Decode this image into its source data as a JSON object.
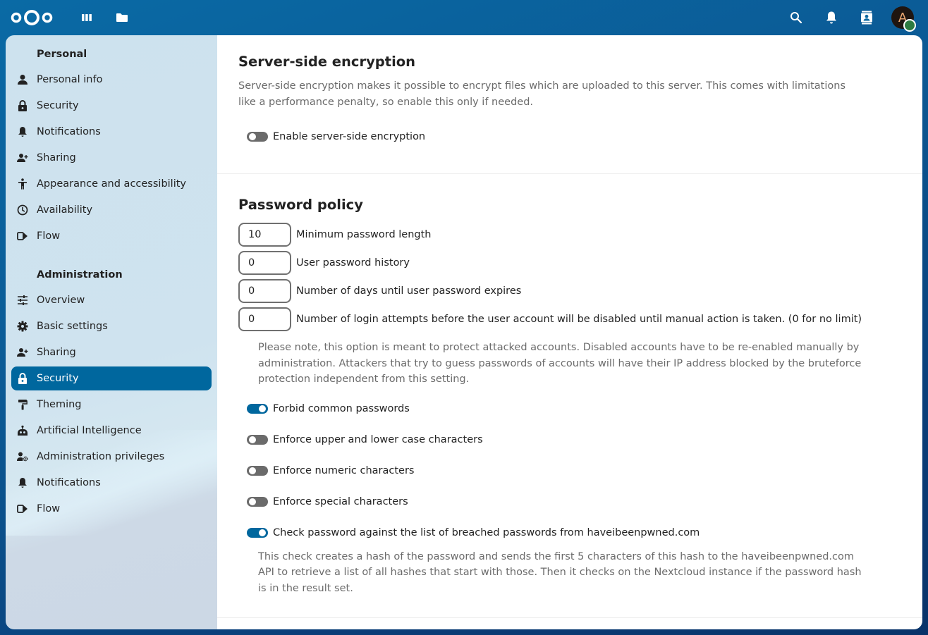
{
  "header": {
    "logo": "nextcloud-logo",
    "left_icons": [
      {
        "name": "dashboard-icon",
        "label": "Dashboard"
      },
      {
        "name": "files-icon",
        "label": "Files"
      }
    ],
    "right_icons": [
      {
        "name": "search-icon",
        "label": "Search"
      },
      {
        "name": "notifications-icon",
        "label": "Notifications"
      },
      {
        "name": "contacts-icon",
        "label": "Contacts"
      }
    ],
    "avatar_initial": "A",
    "status": "online",
    "colors": {
      "primary": "#00679e",
      "avatar_bg": "#1f1510",
      "avatar_fg": "#e9a56f",
      "status": "#2d7b41"
    }
  },
  "sidebar": {
    "personal_heading": "Personal",
    "personal_items": [
      {
        "label": "Personal info",
        "icon": "user-icon"
      },
      {
        "label": "Security",
        "icon": "lock-icon"
      },
      {
        "label": "Notifications",
        "icon": "bell-icon"
      },
      {
        "label": "Sharing",
        "icon": "share-user-icon"
      },
      {
        "label": "Appearance and accessibility",
        "icon": "accessibility-icon"
      },
      {
        "label": "Availability",
        "icon": "clock-icon"
      },
      {
        "label": "Flow",
        "icon": "flow-icon"
      }
    ],
    "admin_heading": "Administration",
    "admin_items": [
      {
        "label": "Overview",
        "icon": "tune-icon"
      },
      {
        "label": "Basic settings",
        "icon": "gear-icon"
      },
      {
        "label": "Sharing",
        "icon": "share-user-icon"
      },
      {
        "label": "Security",
        "icon": "lock-icon",
        "active": true
      },
      {
        "label": "Theming",
        "icon": "paint-roller-icon"
      },
      {
        "label": "Artificial Intelligence",
        "icon": "robot-icon"
      },
      {
        "label": "Administration privileges",
        "icon": "user-cog-icon"
      },
      {
        "label": "Notifications",
        "icon": "bell-icon"
      },
      {
        "label": "Flow",
        "icon": "flow-icon"
      }
    ]
  },
  "encryption": {
    "title": "Server-side encryption",
    "description": "Server-side encryption makes it possible to encrypt files which are uploaded to this server. This comes with limitations like a performance penalty, so enable this only if needed.",
    "toggle_label": "Enable server-side encryption",
    "enabled": false
  },
  "password_policy": {
    "title": "Password policy",
    "fields": [
      {
        "value": "10",
        "label": "Minimum password length"
      },
      {
        "value": "0",
        "label": "User password history"
      },
      {
        "value": "0",
        "label": "Number of days until user password expires"
      },
      {
        "value": "0",
        "label": "Number of login attempts before the user account will be disabled until manual action is taken. (0 for no limit)"
      }
    ],
    "login_attempts_note": "Please note, this option is meant to protect attacked accounts. Disabled accounts have to be re-enabled manually by administration. Attackers that try to guess passwords of accounts will have their IP address blocked by the bruteforce protection independent from this setting.",
    "toggles": [
      {
        "label": "Forbid common passwords",
        "enabled": true
      },
      {
        "label": "Enforce upper and lower case characters",
        "enabled": false
      },
      {
        "label": "Enforce numeric characters",
        "enabled": false
      },
      {
        "label": "Enforce special characters",
        "enabled": false
      },
      {
        "label": "Check password against the list of breached passwords from haveibeenpwned.com",
        "enabled": true
      }
    ],
    "hibp_note": "This check creates a hash of the password and sends the first 5 characters of this hash to the haveibeenpwned.com API to retrieve a list of all hashes that start with those. Then it checks on the Nextcloud instance if the password hash is in the result set."
  }
}
